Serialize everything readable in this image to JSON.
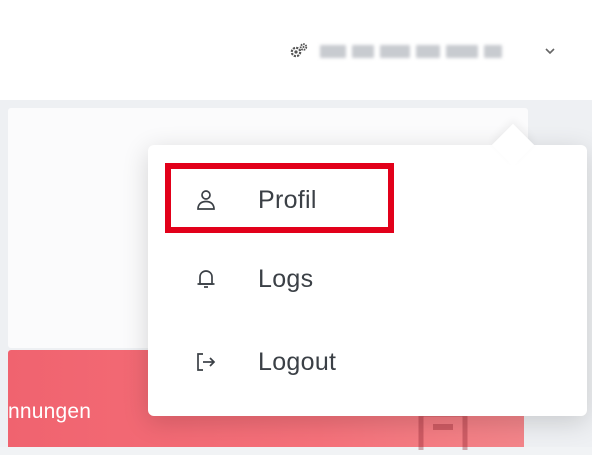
{
  "header": {
    "user_menu": {
      "icon": "gears-icon",
      "chevron_icon": "chevron-down-icon"
    }
  },
  "dropdown": {
    "items": [
      {
        "label": "Profil",
        "icon": "user-icon"
      },
      {
        "label": "Logs",
        "icon": "bell-icon"
      },
      {
        "label": "Logout",
        "icon": "logout-icon"
      }
    ],
    "highlight_color": "#e2001a"
  },
  "background_card": {
    "label": "nnungen",
    "color": "#f0636f"
  }
}
